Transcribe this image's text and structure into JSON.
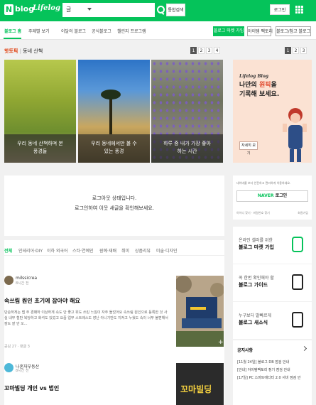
{
  "header": {
    "logo_letter": "N",
    "logo_text": "blog",
    "logo_sub": "Lifelog Blog",
    "search_select": "글",
    "search_placeholder": "",
    "unified_search": "통합검색",
    "login": "로그인",
    "brand_color": "#05c35a"
  },
  "nav": {
    "items": [
      "블로그 홈",
      "주제별 보기",
      "이달의 블로그",
      "공식블로그",
      "챌린지 프로그램"
    ],
    "market_btn": "블로그 마켓 가입",
    "id_btn": "아이템 팩토리",
    "write_btn": "블로그/참고 블로그"
  },
  "topic": {
    "hot": "핫토픽",
    "sep": "|",
    "title": "동네 산책",
    "pages": [
      "1",
      "2",
      "3",
      "4"
    ],
    "ad_pages": [
      "1",
      "2",
      "3"
    ]
  },
  "cards": [
    {
      "caption": "우리 동네 산책하며 본\n풍경들"
    },
    {
      "caption": "우리 동네에서만 볼 수\n있는 풍경"
    },
    {
      "caption": "하루 중 내가 가장 좋아\n하는 시간"
    }
  ],
  "ad": {
    "brand": "Lifelog Blog",
    "line1": "나만의 ",
    "highlight": "원픽",
    "line1_end": "을",
    "line2": "기록해 보세요.",
    "button": "자세히 보기"
  },
  "login_area": {
    "line1": "로그아웃 상태입니다.",
    "line2": "로그인하여 이웃 새글을 확인해보세요."
  },
  "categories": [
    "전체",
    "인테리어·DIY",
    "이하 외국어",
    "스타·연예인",
    "원예·재배",
    "취미",
    "상품리뷰",
    "미술·디자인"
  ],
  "posts": [
    {
      "author": "milssicrea",
      "time": "8시간 전",
      "title": "속쓰림 원인 초기에 잡아야 해요",
      "body": "단순하게는 맵 주 경패하 이상하게 속도 안 좋고 위도 쓰린 느낌이 자주 들었어요 속쓰림 원인으로 등록한 것 사실 내부 철판 복당하고 화석도 있었고 요즘 업무 스트레스도 장난 아니기만도 지켜고 누웠도 속이 너무 불편해서 잠도 잘 안 오...",
      "meta": "공감 27 · 댓글 3"
    },
    {
      "author": "나혼자부동산",
      "time": "8시간 전",
      "title": "꼬마빌딩 개인 vs 법인",
      "thumb_text": "꼬마빌딩"
    }
  ],
  "side": {
    "login_hint": "네이버를 보다 안전하고 편리하게 이용하세요.",
    "naver_login": "NAVER",
    "naver_login_suffix": " 로그인",
    "links": "아이디 찾기 · 비밀번호 찾기",
    "join": "회원가입",
    "boxes": [
      {
        "line1": "온라인 셀러를 위한",
        "line2": "블로그 마켓 가입"
      },
      {
        "line1": "꼭 한번 확인해야 할",
        "line2": "블로그 가이드"
      },
      {
        "line1": "누구보다 발빠르게",
        "line2": "블로그 새소식"
      }
    ],
    "notice_title": "공지사항",
    "notices": [
      "[11월 24일] 블로그 DB 점검 안내",
      "[안내] 아이템팩토리 정기 점검 안내",
      "[17일] PC 스마트에디터 2.0 서비 점검 안"
    ]
  }
}
